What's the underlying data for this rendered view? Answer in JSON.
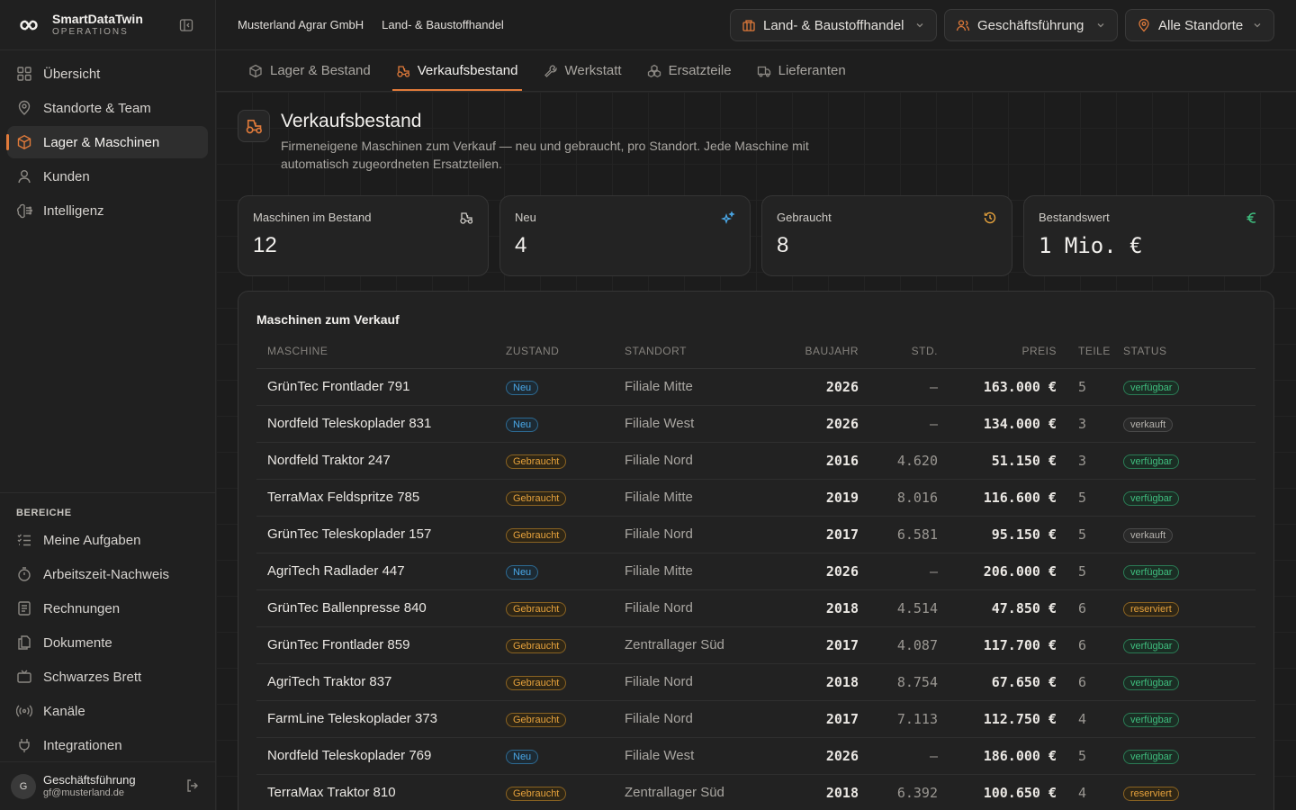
{
  "brand": {
    "name": "SmartDataTwin",
    "sub": "OPERATIONS"
  },
  "nav": [
    {
      "label": "Übersicht",
      "icon": "grid-icon"
    },
    {
      "label": "Standorte & Team",
      "icon": "map-pin-icon"
    },
    {
      "label": "Lager & Maschinen",
      "icon": "box-icon",
      "active": true
    },
    {
      "label": "Kunden",
      "icon": "user-icon"
    },
    {
      "label": "Intelligenz",
      "icon": "brain-icon"
    }
  ],
  "section": {
    "title": "BEREICHE",
    "items": [
      {
        "label": "Meine Aufgaben",
        "icon": "tasks-icon"
      },
      {
        "label": "Arbeitszeit-Nachweis",
        "icon": "timer-icon"
      },
      {
        "label": "Rechnungen",
        "icon": "invoice-icon"
      },
      {
        "label": "Dokumente",
        "icon": "documents-icon"
      },
      {
        "label": "Schwarzes Brett",
        "icon": "board-icon"
      },
      {
        "label": "Kanäle",
        "icon": "radio-icon"
      },
      {
        "label": "Integrationen",
        "icon": "plug-icon"
      }
    ]
  },
  "user": {
    "initial": "G",
    "name": "Geschäftsführung",
    "email": "gf@musterland.de"
  },
  "topbar": {
    "company": "Musterland Agrar GmbH",
    "segment": "Land- & Baustoffhandel",
    "selects": {
      "branch": "Land- & Baustoffhandel",
      "role": "Geschäftsführung",
      "location": "Alle Standorte"
    }
  },
  "tabs": [
    {
      "label": "Lager & Bestand",
      "icon": "box-icon"
    },
    {
      "label": "Verkaufsbestand",
      "icon": "tractor-icon",
      "active": true
    },
    {
      "label": "Werkstatt",
      "icon": "wrench-icon"
    },
    {
      "label": "Ersatzteile",
      "icon": "parts-icon"
    },
    {
      "label": "Lieferanten",
      "icon": "truck-icon"
    }
  ],
  "page": {
    "title": "Verkaufsbestand",
    "description": "Firmeneigene Maschinen zum Verkauf — neu und gebraucht, pro Standort. Jede Maschine mit automatisch zugeordneten Ersatzteilen."
  },
  "stats": [
    {
      "label": "Maschinen im Bestand",
      "value": "12",
      "icon": "tractor-icon",
      "color": "#cfccc7"
    },
    {
      "label": "Neu",
      "value": "4",
      "icon": "sparkles-icon",
      "color": "#4aa8e8"
    },
    {
      "label": "Gebraucht",
      "value": "8",
      "icon": "history-icon",
      "color": "#e6a23c"
    },
    {
      "label": "Bestandswert",
      "value": "1 Mio. €",
      "icon": "euro-icon",
      "color": "#3fbf7f"
    }
  ],
  "table": {
    "title": "Maschinen zum Verkauf",
    "columns": [
      "MASCHINE",
      "ZUSTAND",
      "STANDORT",
      "BAUJAHR",
      "STD.",
      "PREIS",
      "TEILE",
      "STATUS"
    ],
    "rows": [
      {
        "name": "GrünTec Frontlader 791",
        "zustand": "Neu",
        "standort": "Filiale Mitte",
        "baujahr": "2026",
        "std": "—",
        "preis": "163.000 €",
        "teile": "5",
        "status": "verfügbar"
      },
      {
        "name": "Nordfeld Teleskoplader 831",
        "zustand": "Neu",
        "standort": "Filiale West",
        "baujahr": "2026",
        "std": "—",
        "preis": "134.000 €",
        "teile": "3",
        "status": "verkauft"
      },
      {
        "name": "Nordfeld Traktor 247",
        "zustand": "Gebraucht",
        "standort": "Filiale Nord",
        "baujahr": "2016",
        "std": "4.620",
        "preis": "51.150 €",
        "teile": "3",
        "status": "verfügbar"
      },
      {
        "name": "TerraMax Feldspritze 785",
        "zustand": "Gebraucht",
        "standort": "Filiale Mitte",
        "baujahr": "2019",
        "std": "8.016",
        "preis": "116.600 €",
        "teile": "5",
        "status": "verfügbar"
      },
      {
        "name": "GrünTec Teleskoplader 157",
        "zustand": "Gebraucht",
        "standort": "Filiale Nord",
        "baujahr": "2017",
        "std": "6.581",
        "preis": "95.150 €",
        "teile": "5",
        "status": "verkauft"
      },
      {
        "name": "AgriTech Radlader 447",
        "zustand": "Neu",
        "standort": "Filiale Mitte",
        "baujahr": "2026",
        "std": "—",
        "preis": "206.000 €",
        "teile": "5",
        "status": "verfügbar"
      },
      {
        "name": "GrünTec Ballenpresse 840",
        "zustand": "Gebraucht",
        "standort": "Filiale Nord",
        "baujahr": "2018",
        "std": "4.514",
        "preis": "47.850 €",
        "teile": "6",
        "status": "reserviert"
      },
      {
        "name": "GrünTec Frontlader 859",
        "zustand": "Gebraucht",
        "standort": "Zentrallager Süd",
        "baujahr": "2017",
        "std": "4.087",
        "preis": "117.700 €",
        "teile": "6",
        "status": "verfügbar"
      },
      {
        "name": "AgriTech Traktor 837",
        "zustand": "Gebraucht",
        "standort": "Filiale Nord",
        "baujahr": "2018",
        "std": "8.754",
        "preis": "67.650 €",
        "teile": "6",
        "status": "verfügbar"
      },
      {
        "name": "FarmLine Teleskoplader 373",
        "zustand": "Gebraucht",
        "standort": "Filiale Nord",
        "baujahr": "2017",
        "std": "7.113",
        "preis": "112.750 €",
        "teile": "4",
        "status": "verfügbar"
      },
      {
        "name": "Nordfeld Teleskoplader 769",
        "zustand": "Neu",
        "standort": "Filiale West",
        "baujahr": "2026",
        "std": "—",
        "preis": "186.000 €",
        "teile": "5",
        "status": "verfügbar"
      },
      {
        "name": "TerraMax Traktor 810",
        "zustand": "Gebraucht",
        "standort": "Zentrallager Süd",
        "baujahr": "2018",
        "std": "6.392",
        "preis": "100.650 €",
        "teile": "4",
        "status": "reserviert"
      }
    ]
  },
  "colors": {
    "accent": "#e07a3a",
    "neu": "#4aa8e8",
    "gebraucht": "#e6a23c",
    "verfuegbar": "#3fbf7f"
  }
}
